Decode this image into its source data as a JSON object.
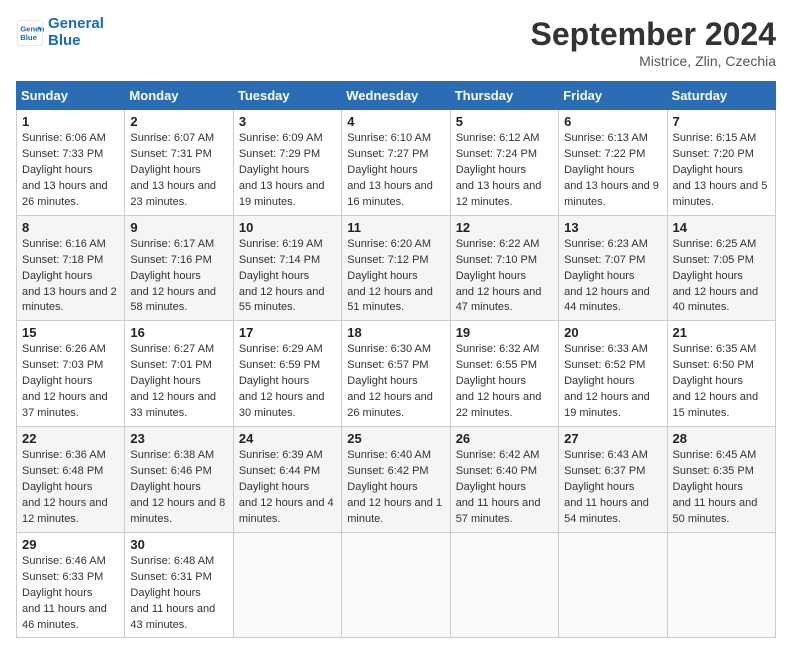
{
  "logo": {
    "line1": "General",
    "line2": "Blue"
  },
  "title": "September 2024",
  "location": "Mistrice, Zlin, Czechia",
  "days_of_week": [
    "Sunday",
    "Monday",
    "Tuesday",
    "Wednesday",
    "Thursday",
    "Friday",
    "Saturday"
  ],
  "weeks": [
    [
      {
        "num": "1",
        "rise": "6:06 AM",
        "set": "7:33 PM",
        "daylight": "13 hours and 26 minutes."
      },
      {
        "num": "2",
        "rise": "6:07 AM",
        "set": "7:31 PM",
        "daylight": "13 hours and 23 minutes."
      },
      {
        "num": "3",
        "rise": "6:09 AM",
        "set": "7:29 PM",
        "daylight": "13 hours and 19 minutes."
      },
      {
        "num": "4",
        "rise": "6:10 AM",
        "set": "7:27 PM",
        "daylight": "13 hours and 16 minutes."
      },
      {
        "num": "5",
        "rise": "6:12 AM",
        "set": "7:24 PM",
        "daylight": "13 hours and 12 minutes."
      },
      {
        "num": "6",
        "rise": "6:13 AM",
        "set": "7:22 PM",
        "daylight": "13 hours and 9 minutes."
      },
      {
        "num": "7",
        "rise": "6:15 AM",
        "set": "7:20 PM",
        "daylight": "13 hours and 5 minutes."
      }
    ],
    [
      {
        "num": "8",
        "rise": "6:16 AM",
        "set": "7:18 PM",
        "daylight": "13 hours and 2 minutes."
      },
      {
        "num": "9",
        "rise": "6:17 AM",
        "set": "7:16 PM",
        "daylight": "12 hours and 58 minutes."
      },
      {
        "num": "10",
        "rise": "6:19 AM",
        "set": "7:14 PM",
        "daylight": "12 hours and 55 minutes."
      },
      {
        "num": "11",
        "rise": "6:20 AM",
        "set": "7:12 PM",
        "daylight": "12 hours and 51 minutes."
      },
      {
        "num": "12",
        "rise": "6:22 AM",
        "set": "7:10 PM",
        "daylight": "12 hours and 47 minutes."
      },
      {
        "num": "13",
        "rise": "6:23 AM",
        "set": "7:07 PM",
        "daylight": "12 hours and 44 minutes."
      },
      {
        "num": "14",
        "rise": "6:25 AM",
        "set": "7:05 PM",
        "daylight": "12 hours and 40 minutes."
      }
    ],
    [
      {
        "num": "15",
        "rise": "6:26 AM",
        "set": "7:03 PM",
        "daylight": "12 hours and 37 minutes."
      },
      {
        "num": "16",
        "rise": "6:27 AM",
        "set": "7:01 PM",
        "daylight": "12 hours and 33 minutes."
      },
      {
        "num": "17",
        "rise": "6:29 AM",
        "set": "6:59 PM",
        "daylight": "12 hours and 30 minutes."
      },
      {
        "num": "18",
        "rise": "6:30 AM",
        "set": "6:57 PM",
        "daylight": "12 hours and 26 minutes."
      },
      {
        "num": "19",
        "rise": "6:32 AM",
        "set": "6:55 PM",
        "daylight": "12 hours and 22 minutes."
      },
      {
        "num": "20",
        "rise": "6:33 AM",
        "set": "6:52 PM",
        "daylight": "12 hours and 19 minutes."
      },
      {
        "num": "21",
        "rise": "6:35 AM",
        "set": "6:50 PM",
        "daylight": "12 hours and 15 minutes."
      }
    ],
    [
      {
        "num": "22",
        "rise": "6:36 AM",
        "set": "6:48 PM",
        "daylight": "12 hours and 12 minutes."
      },
      {
        "num": "23",
        "rise": "6:38 AM",
        "set": "6:46 PM",
        "daylight": "12 hours and 8 minutes."
      },
      {
        "num": "24",
        "rise": "6:39 AM",
        "set": "6:44 PM",
        "daylight": "12 hours and 4 minutes."
      },
      {
        "num": "25",
        "rise": "6:40 AM",
        "set": "6:42 PM",
        "daylight": "12 hours and 1 minute."
      },
      {
        "num": "26",
        "rise": "6:42 AM",
        "set": "6:40 PM",
        "daylight": "11 hours and 57 minutes."
      },
      {
        "num": "27",
        "rise": "6:43 AM",
        "set": "6:37 PM",
        "daylight": "11 hours and 54 minutes."
      },
      {
        "num": "28",
        "rise": "6:45 AM",
        "set": "6:35 PM",
        "daylight": "11 hours and 50 minutes."
      }
    ],
    [
      {
        "num": "29",
        "rise": "6:46 AM",
        "set": "6:33 PM",
        "daylight": "11 hours and 46 minutes."
      },
      {
        "num": "30",
        "rise": "6:48 AM",
        "set": "6:31 PM",
        "daylight": "11 hours and 43 minutes."
      },
      null,
      null,
      null,
      null,
      null
    ]
  ]
}
